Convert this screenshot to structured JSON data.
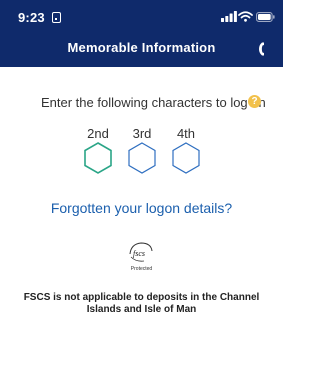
{
  "status_bar": {
    "time": "9:23"
  },
  "header": {
    "title": "Memorable Information",
    "background_color": "#0f2a6b"
  },
  "instruction": {
    "text": "Enter the following characters to log on",
    "help_icon": "question-circle-icon",
    "help_glyph": "?"
  },
  "positions": [
    {
      "label": "2nd",
      "state": "focused"
    },
    {
      "label": "3rd",
      "state": "empty"
    },
    {
      "label": "4th",
      "state": "empty"
    }
  ],
  "colors": {
    "focused_border": "#2aa587",
    "default_border": "#2f6fc0",
    "link": "#1b5fad",
    "help_badge": "#f2c14b"
  },
  "forgot_link": {
    "label": "Forgotten your logon details?"
  },
  "fscs": {
    "logo_text": "fscs",
    "caption": "Protected"
  },
  "notice": {
    "text": "FSCS is not applicable to deposits in the Channel Islands and Isle of Man"
  }
}
